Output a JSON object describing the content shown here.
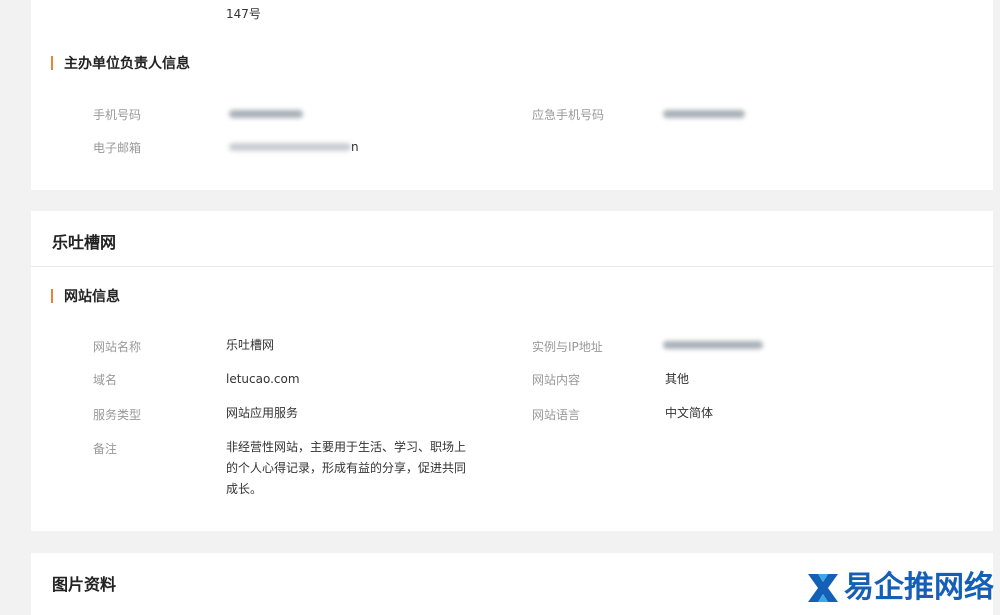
{
  "owner_card": {
    "address_tail": "147号",
    "section_title": "主办单位负责人信息",
    "phone_label": "手机号码",
    "emergency_phone_label": "应急手机号码",
    "email_label": "电子邮箱",
    "email_visible_tail": "n"
  },
  "site_card": {
    "title": "乐吐槽网",
    "section_title": "网站信息",
    "fields": {
      "site_name_label": "网站名称",
      "site_name_value": "乐吐槽网",
      "instance_ip_label": "实例与IP地址",
      "domain_label": "域名",
      "domain_value": "letucao.com",
      "content_label": "网站内容",
      "content_value": "其他",
      "service_type_label": "服务类型",
      "service_type_value": "网站应用服务",
      "language_label": "网站语言",
      "language_value": "中文简体",
      "remark_label": "备注",
      "remark_value_line1": "非经营性网站，主要用于生活、学习、职场上",
      "remark_value_line2": "的个人心得记录，形成有益的分享，促进共同",
      "remark_value_line3": "成长。"
    }
  },
  "images_card": {
    "title": "图片资料"
  },
  "watermark": {
    "text": "易企推网络",
    "color": "#1560b7"
  },
  "colors": {
    "accent": "#e8833a",
    "background": "#f2f2f2",
    "card": "#ffffff"
  }
}
